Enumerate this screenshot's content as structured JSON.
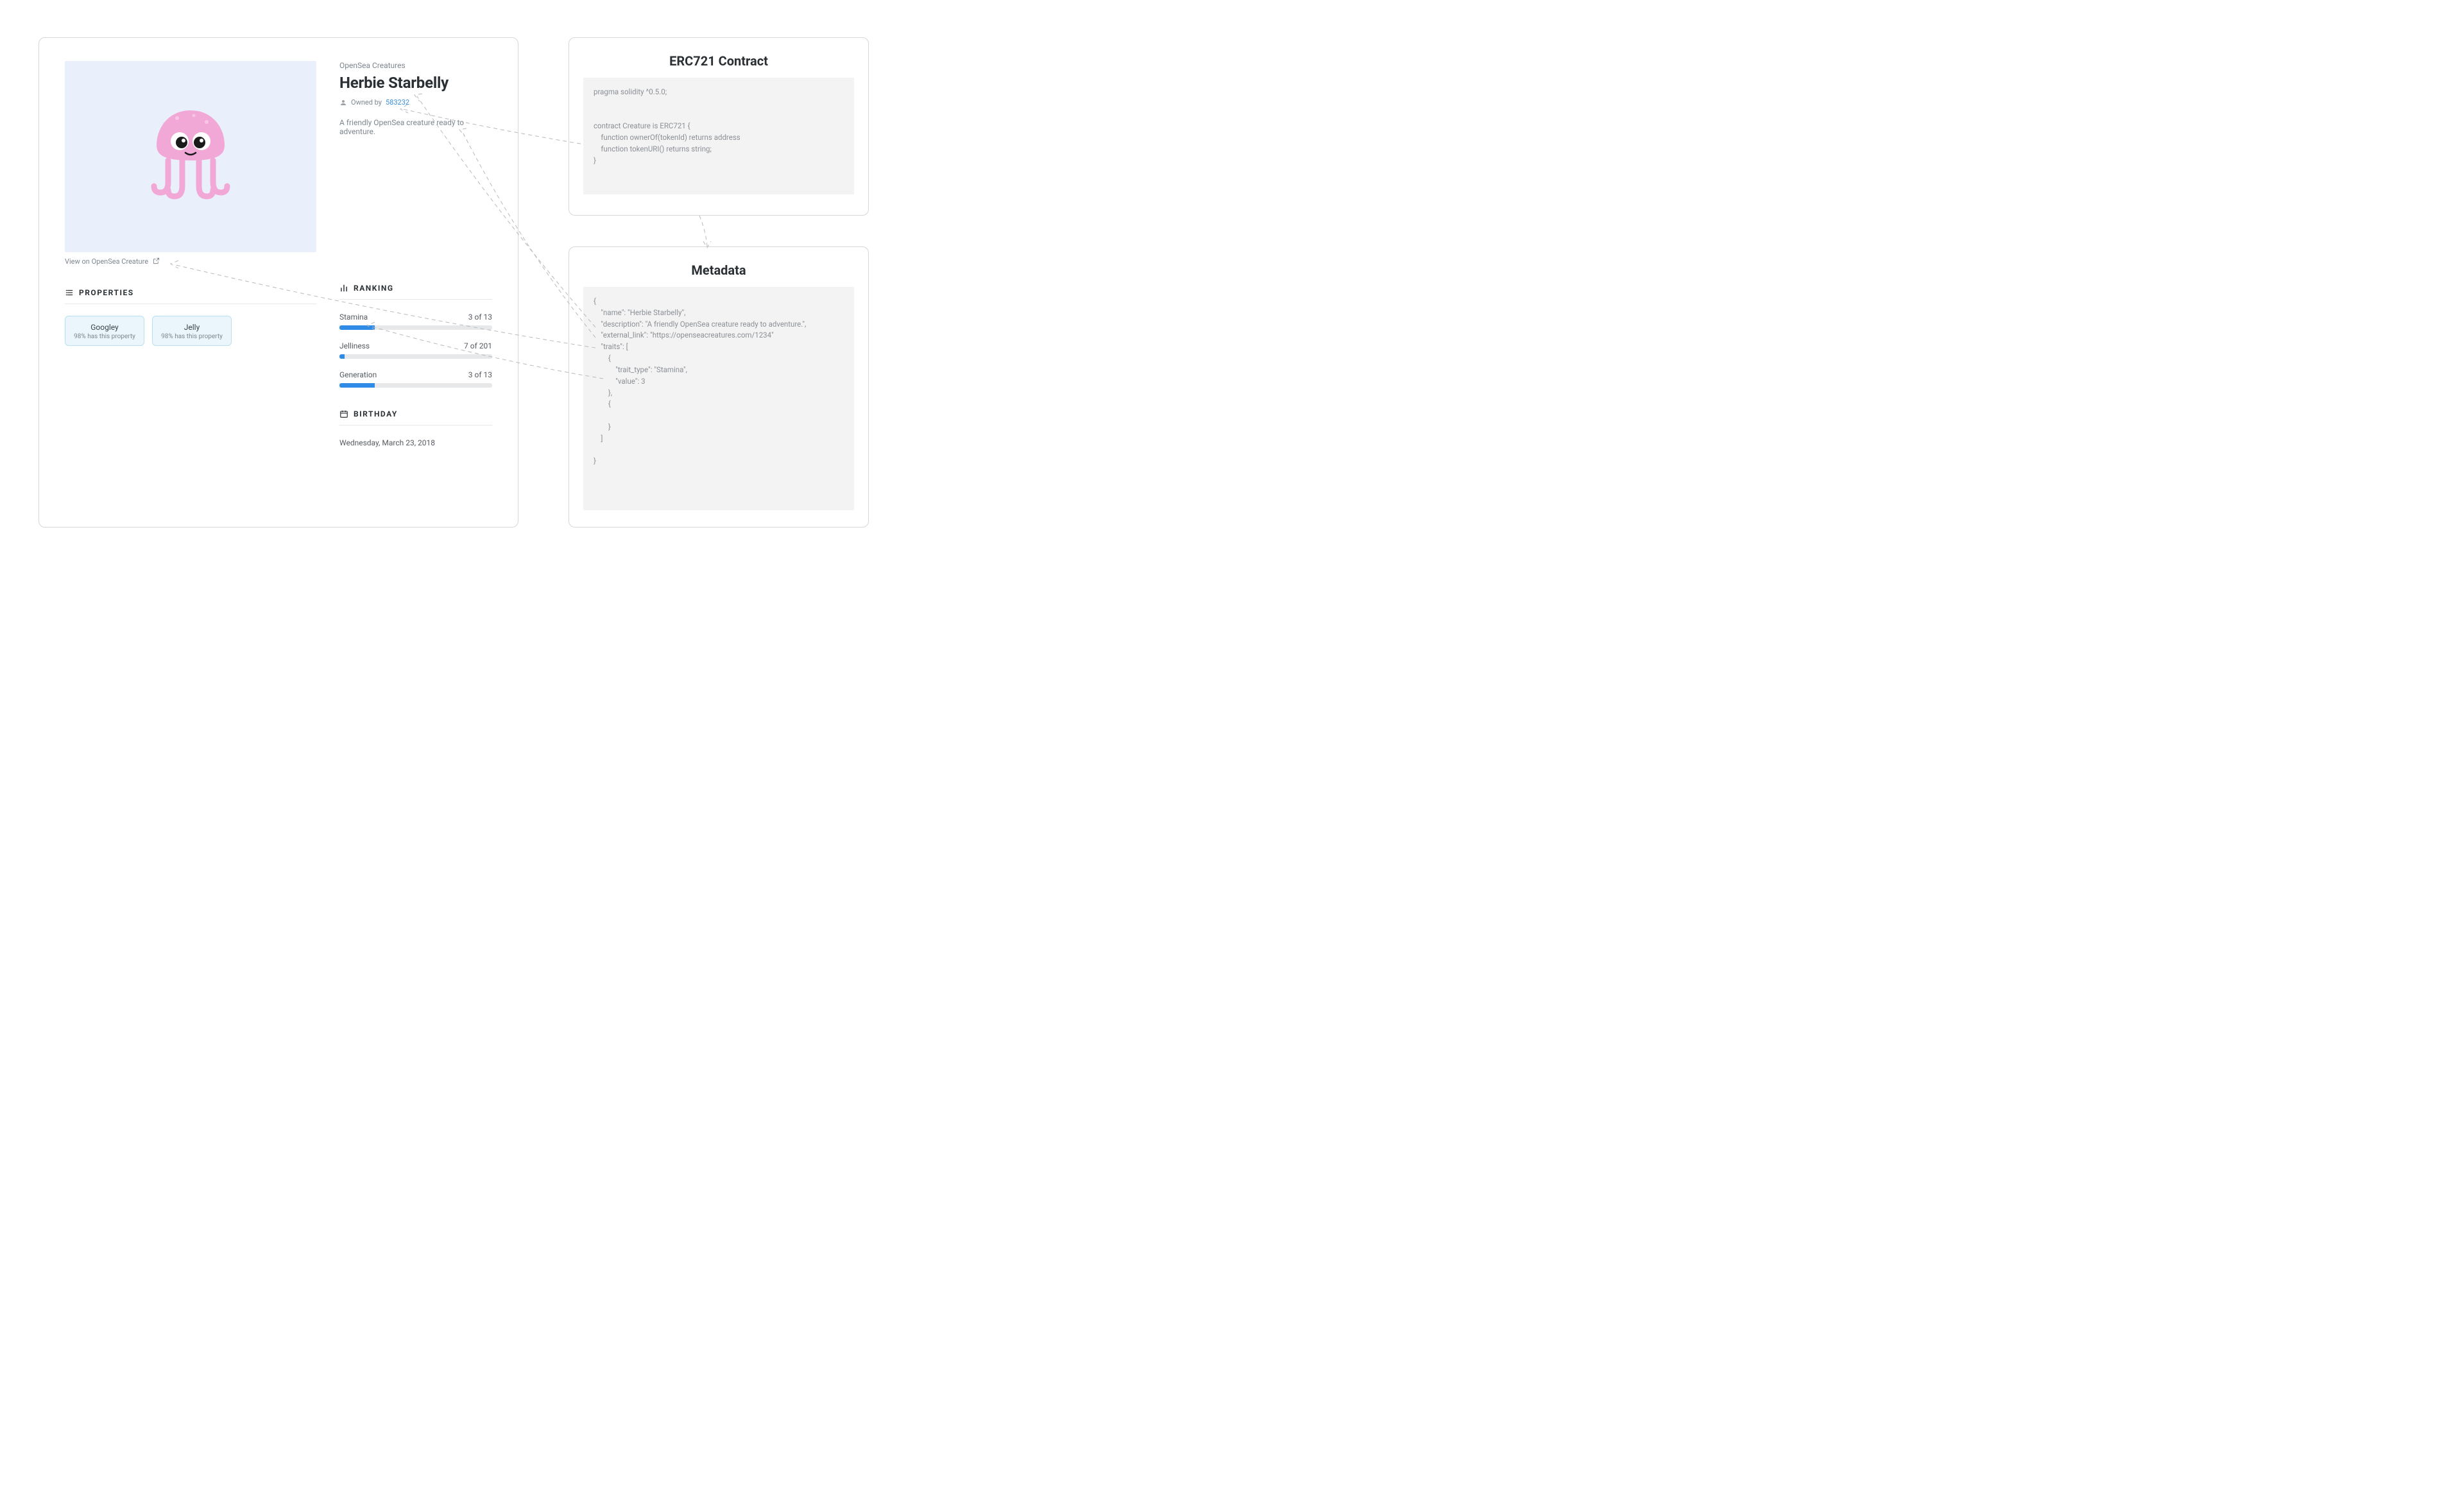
{
  "listing": {
    "collection": "OpenSea Creatures",
    "name": "Herbie Starbelly",
    "owned_by_prefix": "Owned by",
    "owner": "583232",
    "description": "A friendly OpenSea creature ready to adventure.",
    "view_link": "View on OpenSea Creature",
    "properties_heading": "PROPERTIES",
    "properties": [
      {
        "name": "Googley",
        "sub": "98% has this property"
      },
      {
        "name": "Jelly",
        "sub": "98% has this property"
      }
    ],
    "ranking_heading": "RANKING",
    "rankings": [
      {
        "name": "Stamina",
        "value": 3,
        "of": 13,
        "pct": 23
      },
      {
        "name": "Jelliness",
        "value": 7,
        "of": 201,
        "pct": 3.5
      },
      {
        "name": "Generation",
        "value": 3,
        "of": 13,
        "pct": 23
      }
    ],
    "birthday_heading": "BIRTHDAY",
    "birthday": "Wednesday, March 23, 2018"
  },
  "contract": {
    "title": "ERC721 Contract",
    "code": "pragma solidity ^0.5.0;\n\n\ncontract Creature is ERC721 {\n    function ownerOf(tokenId) returns address\n    function tokenURI() returns string;\n}"
  },
  "metadata": {
    "title": "Metadata",
    "code": "{\n    \"name\": \"Herbie Starbelly\",\n    \"description\": \"A friendly OpenSea creature ready to adventure.\",\n    \"external_link\": \"https://openseacreatures.com/1234\"\n    \"traits\": [\n        {\n            \"trait_type\": \"Stamina\",\n            \"value\": 3\n        },\n        {\n\n        }\n    ]\n\n}"
  }
}
